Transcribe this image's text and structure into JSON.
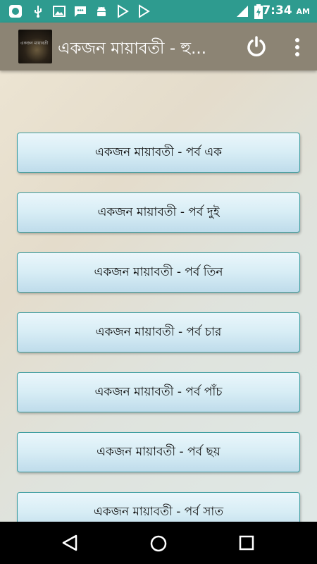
{
  "status_bar": {
    "time": "7:34",
    "ampm": "AM",
    "left_icons": [
      "app-notification-icon",
      "usb-icon",
      "image-icon",
      "message-icon",
      "android-icon",
      "play-store-icon",
      "play-store-icon"
    ],
    "right_icons": [
      "signal-icon",
      "battery-charging-icon"
    ]
  },
  "app_bar": {
    "title": "একজন মায়াবতী - হু...",
    "logo_text": "একজন মায়াবতী",
    "actions": [
      "power-icon",
      "overflow-menu-icon"
    ]
  },
  "parts": [
    {
      "label": "একজন মায়াবতী - পর্ব এক"
    },
    {
      "label": "একজন মায়াবতী - পর্ব দুই"
    },
    {
      "label": "একজন মায়াবতী - পর্ব তিন"
    },
    {
      "label": "একজন মায়াবতী - পর্ব চার"
    },
    {
      "label": "একজন মায়াবতী - পর্ব পাঁচ"
    },
    {
      "label": "একজন মায়াবতী - পর্ব ছয়"
    },
    {
      "label": "একজন মায়াবতী - পর্ব সাত"
    }
  ],
  "nav_bar": {
    "buttons": [
      "back-icon",
      "home-icon",
      "recents-icon"
    ]
  },
  "colors": {
    "status_bar": "#2e9b8f",
    "app_bar": "#8c8474",
    "button_border": "#3d9da0"
  }
}
